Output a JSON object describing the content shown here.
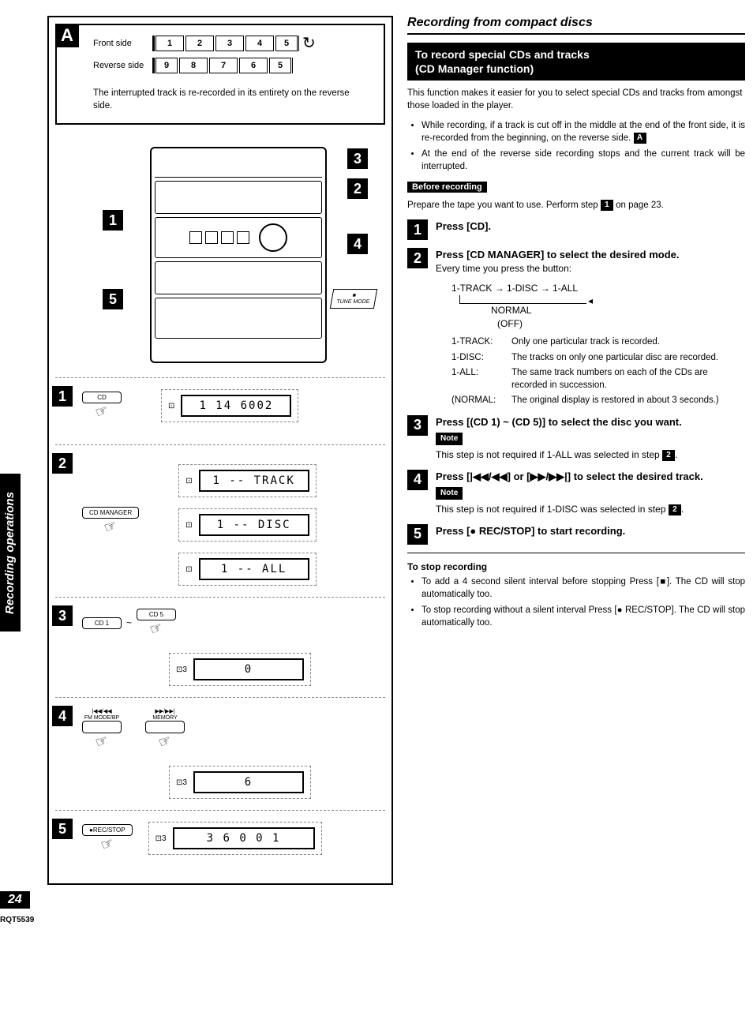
{
  "side_tab": "Recording operations",
  "page_number": "24",
  "doc_id": "RQT5539",
  "box_a": {
    "letter": "A",
    "front_label": "Front side",
    "reverse_label": "Reverse side",
    "front_cells": [
      "1",
      "2",
      "3",
      "4",
      "5"
    ],
    "reverse_cells": [
      "9",
      "8",
      "7",
      "6",
      "5"
    ],
    "caption": "The interrupted track is re-recorded in its entirety on the reverse side."
  },
  "diagram_callouts": {
    "c1": "1",
    "c2": "2",
    "c3": "3",
    "c4": "4",
    "c5": "5",
    "tune_mode": "TUNE MODE"
  },
  "left_steps": {
    "s1": {
      "num": "1",
      "btn": "CD",
      "lcd": "1  14  6002"
    },
    "s2": {
      "num": "2",
      "btn": "CD MANAGER",
      "lcd_a": "1 -- TRACK",
      "lcd_b": "1 -- DISC",
      "lcd_c": "1 -- ALL"
    },
    "s3": {
      "num": "3",
      "btn_a": "CD 1",
      "btn_b": "CD 5",
      "tilde": "~",
      "lcd": "0"
    },
    "s4": {
      "num": "4",
      "btn_a_top": "|◀◀/◀◀",
      "btn_a_bot": "FM MODE/BP",
      "btn_b_top": "▶▶/▶▶|",
      "btn_b_bot": "MEMORY",
      "lcd": "6"
    },
    "s5": {
      "num": "5",
      "btn": "●REC/STOP",
      "lcd": "3     6    0 0  1"
    }
  },
  "right": {
    "header": "Recording from compact discs",
    "black_bar_l1": "To record special CDs and tracks",
    "black_bar_l2": "(CD Manager function)",
    "intro": "This function makes it easier for you to select special CDs and tracks from amongst those loaded in the player.",
    "bullet1_a": "While recording, if a track is cut off in the middle at the end of the front side, it is re-recorded from the beginning, on the reverse side.",
    "bullet1_badge": "A",
    "bullet2": "At the end of the reverse side recording stops and the current track will be interrupted.",
    "before_label": "Before recording",
    "before_text_a": "Prepare the tape you want to use. Perform step",
    "before_badge": "1",
    "before_text_b": "on page 23.",
    "step1": {
      "num": "1",
      "title": "Press [CD]."
    },
    "step2": {
      "num": "2",
      "title": "Press [CD MANAGER] to select the desired mode.",
      "sub": "Every time you press the button:",
      "cycle_l1": "1-TRACK → 1-DISC → 1-ALL",
      "cycle_l2": "NORMAL",
      "cycle_l3": "(OFF)",
      "m1k": "1-TRACK:",
      "m1v": "Only one particular track is recorded.",
      "m2k": "1-DISC:",
      "m2v": "The tracks on only one particular disc are recorded.",
      "m3k": "1-ALL:",
      "m3v": "The same track numbers on each of the CDs are recorded in succession.",
      "m4k": "(NORMAL:",
      "m4v": "The original display is restored in about 3 seconds.)"
    },
    "step3": {
      "num": "3",
      "title": "Press [(CD 1) ~ (CD 5)] to select the disc you want.",
      "note": "Note",
      "note_text_a": "This step is not required if 1-ALL was selected in step",
      "note_badge": "2",
      "note_text_b": "."
    },
    "step4": {
      "num": "4",
      "title": "Press [|◀◀/◀◀] or [▶▶/▶▶|] to select the desired track.",
      "note": "Note",
      "note_text_a": "This step is not required if 1-DISC was selected in step",
      "note_badge": "2",
      "note_text_b": "."
    },
    "step5": {
      "num": "5",
      "title": "Press [● REC/STOP] to start recording."
    },
    "stop": {
      "heading": "To stop recording",
      "b1": "To add a 4 second silent interval before stopping Press [■]. The CD will stop automatically too.",
      "b2": "To stop recording without a silent interval Press [● REC/STOP]. The CD will stop automatically too."
    }
  }
}
